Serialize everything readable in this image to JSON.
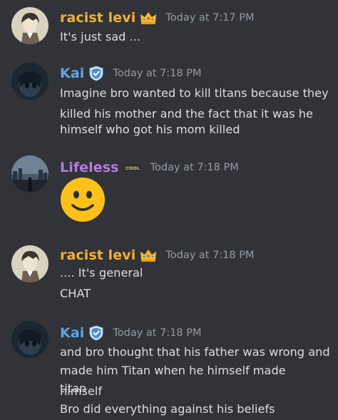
{
  "colors": {
    "background": "#313338",
    "text": "#dbdee1",
    "timestamp": "#949ba4",
    "user_levi": "#f0b232",
    "user_kai": "#5ba6e8",
    "user_lifeless": "#b57be0"
  },
  "messages": [
    {
      "username": "racist levi",
      "badge_icon": "crown-icon",
      "timestamp": "Today at 7:17 PM",
      "lines": [
        "It's just sad ..."
      ]
    },
    {
      "username": "Kai",
      "badge_icon": "shield-check-icon",
      "timestamp": "Today at 7:18 PM",
      "lines": [
        "Imagine bro wanted to kill titans because they",
        "killed his mother and the fact that it was he",
        "himself who got his mom killed"
      ]
    },
    {
      "username": "Lifeless",
      "badge_icon": "cool-icon",
      "badge_text": "COOL",
      "timestamp": "Today at 7:18 PM",
      "emoji": "slightly-smiling-face-icon"
    },
    {
      "username": "racist levi",
      "badge_icon": "crown-icon",
      "timestamp": "Today at 7:18 PM",
      "lines": [
        ".... It's general",
        "CHAT"
      ]
    },
    {
      "username": "Kai",
      "badge_icon": "shield-check-icon",
      "timestamp": "Today at 7:18 PM",
      "lines": [
        "and bro thought that his father was wrong and",
        "made him Titan when he himself made himself",
        "titan",
        "Bro did everything against his beliefs"
      ]
    }
  ]
}
